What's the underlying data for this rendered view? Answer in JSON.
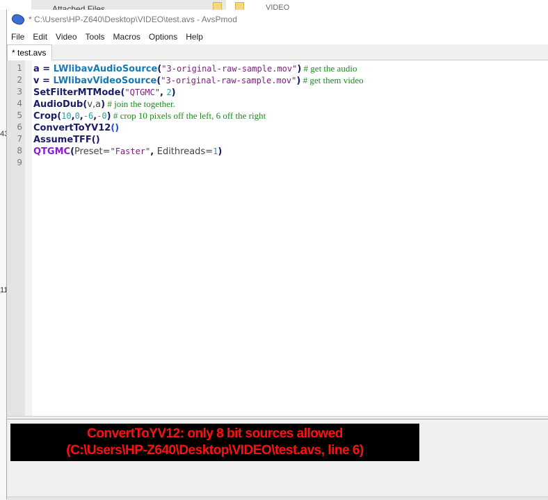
{
  "background": {
    "attached_files": "Attached Files",
    "video_folder": "VIDEO",
    "left_numbers": [
      "43",
      "11"
    ]
  },
  "window": {
    "title": "* C:\\Users\\HP-Z640\\Desktop\\VIDEO\\test.avs - AvsPmod",
    "menu": [
      "File",
      "Edit",
      "Video",
      "Tools",
      "Macros",
      "Options",
      "Help"
    ],
    "tab": "* test.avs"
  },
  "editor": {
    "line_numbers": [
      "1",
      "2",
      "3",
      "4",
      "5",
      "6",
      "7",
      "8",
      "9"
    ],
    "lines": [
      [
        {
          "t": "a",
          "c": "kw"
        },
        {
          "t": " = ",
          "c": "op"
        },
        {
          "t": "LWlibavAudioSource",
          "c": "fn"
        },
        {
          "t": "(",
          "c": "op"
        },
        {
          "t": "\"3-original-raw-sample.mov\"",
          "c": "st"
        },
        {
          "t": ")",
          "c": "op"
        },
        {
          "t": " # get the audio",
          "c": "cm"
        }
      ],
      [
        {
          "t": "v",
          "c": "kw"
        },
        {
          "t": " = ",
          "c": "op"
        },
        {
          "t": "LWlibavVideoSource",
          "c": "fn"
        },
        {
          "t": "(",
          "c": "op"
        },
        {
          "t": "\"3-original-raw-sample.mov\"",
          "c": "st"
        },
        {
          "t": ")",
          "c": "op"
        },
        {
          "t": " # get them video",
          "c": "cm"
        }
      ],
      [
        {
          "t": "SetFilterMTMode",
          "c": "kw"
        },
        {
          "t": "(",
          "c": "op"
        },
        {
          "t": "\"QTGMC\"",
          "c": "st"
        },
        {
          "t": ", ",
          "c": "op"
        },
        {
          "t": "2",
          "c": "nm"
        },
        {
          "t": ")",
          "c": "op"
        }
      ],
      [
        {
          "t": "AudioDub",
          "c": "kw"
        },
        {
          "t": "(",
          "c": "op"
        },
        {
          "t": "v,a",
          "c": "tx"
        },
        {
          "t": ")",
          "c": "op"
        },
        {
          "t": " # join the together.",
          "c": "cm"
        }
      ],
      [
        {
          "t": "Crop",
          "c": "kw"
        },
        {
          "t": "(",
          "c": "op"
        },
        {
          "t": "10",
          "c": "nm"
        },
        {
          "t": ",",
          "c": "op"
        },
        {
          "t": "0",
          "c": "nm"
        },
        {
          "t": ",",
          "c": "op"
        },
        {
          "t": "-6",
          "c": "nm"
        },
        {
          "t": ",",
          "c": "op"
        },
        {
          "t": "-0",
          "c": "nm"
        },
        {
          "t": ")",
          "c": "op"
        },
        {
          "t": " # crop 10 pixels off the left, 6 off the right",
          "c": "cm"
        }
      ],
      [
        {
          "t": "ConvertToYV12",
          "c": "kw"
        },
        {
          "t": "()",
          "c": "bl"
        }
      ],
      [
        {
          "t": "AssumeTFF",
          "c": "kw"
        },
        {
          "t": "()",
          "c": "op"
        }
      ],
      [
        {
          "t": "QTGMC",
          "c": "pu"
        },
        {
          "t": "(",
          "c": "op"
        },
        {
          "t": "Preset=",
          "c": "tx"
        },
        {
          "t": "\"Faster\"",
          "c": "st"
        },
        {
          "t": ", ",
          "c": "op"
        },
        {
          "t": "Edithreads=",
          "c": "tx"
        },
        {
          "t": "1",
          "c": "nm"
        },
        {
          "t": ")",
          "c": "op"
        }
      ],
      []
    ]
  },
  "output": {
    "error_line1": "ConvertToYV12: only 8 bit sources allowed",
    "error_line2": "(C:\\Users\\HP-Z640\\Desktop\\VIDEO\\test.avs, line 6)"
  }
}
